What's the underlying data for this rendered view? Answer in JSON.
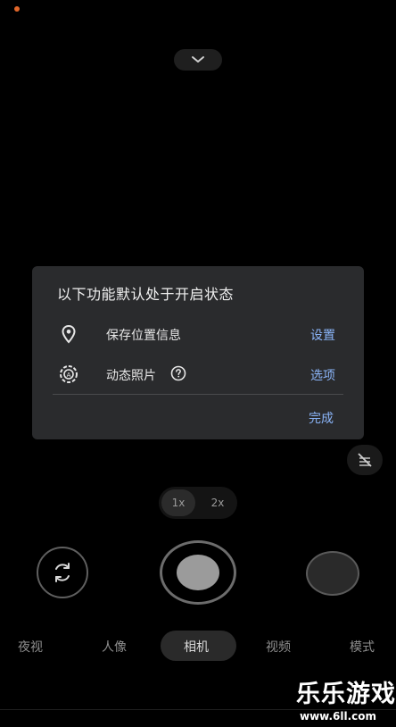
{
  "dialog": {
    "title": "以下功能默认处于开启状态",
    "rows": [
      {
        "icon": "location-pin-icon",
        "label": "保存位置信息",
        "action": "设置"
      },
      {
        "icon": "motion-photo-icon",
        "label": "动态照片",
        "action": "选项"
      }
    ],
    "done": "完成"
  },
  "zoom": {
    "options": [
      "1x",
      "2x"
    ],
    "selected": "1x"
  },
  "modes": [
    "夜视",
    "人像",
    "相机",
    "视频",
    "模式"
  ],
  "selected_mode": "相机",
  "watermark": {
    "title": "乐乐游戏",
    "url": "www.6ll.com"
  },
  "colors": {
    "accent": "#8ab4f8",
    "dialog_bg": "#2a2b2d",
    "indicator": "#e0662a"
  }
}
